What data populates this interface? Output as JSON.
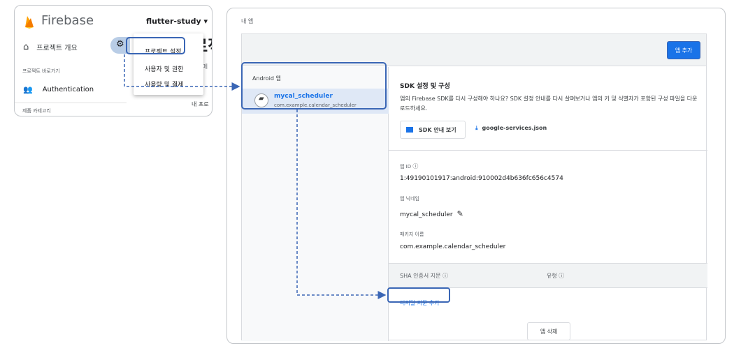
{
  "colors": {
    "accent": "#1a73e8",
    "highlight": "#3a66b5",
    "firebase_yellow": "#f5a623"
  },
  "left": {
    "logo_text": "Firebase",
    "project": "flutter-study ▾",
    "home_label": "프로젝트 개요",
    "big_title": "프로젝트 -",
    "shortcut_label": "프로젝트 바로가기",
    "auth_label": "Authentication",
    "product_category": "제품 카테고리",
    "right_text_1": "카우드 메",
    "right_text_2": "내 프로",
    "menu": [
      "프로젝트 설정",
      "사용자 및 권한",
      "사용량 및 결제"
    ]
  },
  "right": {
    "section_title": "내 앱",
    "add_app_button": "앱 추가",
    "android_label": "Android 앱",
    "app": {
      "name": "mycal_scheduler",
      "package": "com.example.calendar_scheduler"
    },
    "sdk_title": "SDK 설정 및 구성",
    "sdk_desc": "앱의 Firebase SDK를 다시 구성해야 하나요? SDK 설정 안내를 다시 살펴보거나 앱의 키 및 식별자가 포함된 구성 파일을 다운로드하세요.",
    "sdk_guide_button": "SDK 안내 보기",
    "download_json": "google-services.json",
    "app_id_label": "앱 ID",
    "app_id_value": "1:49190101917:android:910002d4b636fc656c4574",
    "nickname_label": "앱 닉네임",
    "nickname_value": "mycal_scheduler",
    "package_label": "패키지 이름",
    "package_value": "com.example.calendar_scheduler",
    "sha_label": "SHA 인증서 지문",
    "type_label": "유형",
    "add_fingerprint": "디지털 지문 추가",
    "delete_app": "앱 삭제"
  },
  "icons": {
    "help": "?",
    "home": "home-icon",
    "people": "people-icon",
    "gear": "gear-icon",
    "edit": "pencil-icon",
    "download": "download-icon",
    "book": "book-icon",
    "android": "android-icon"
  }
}
